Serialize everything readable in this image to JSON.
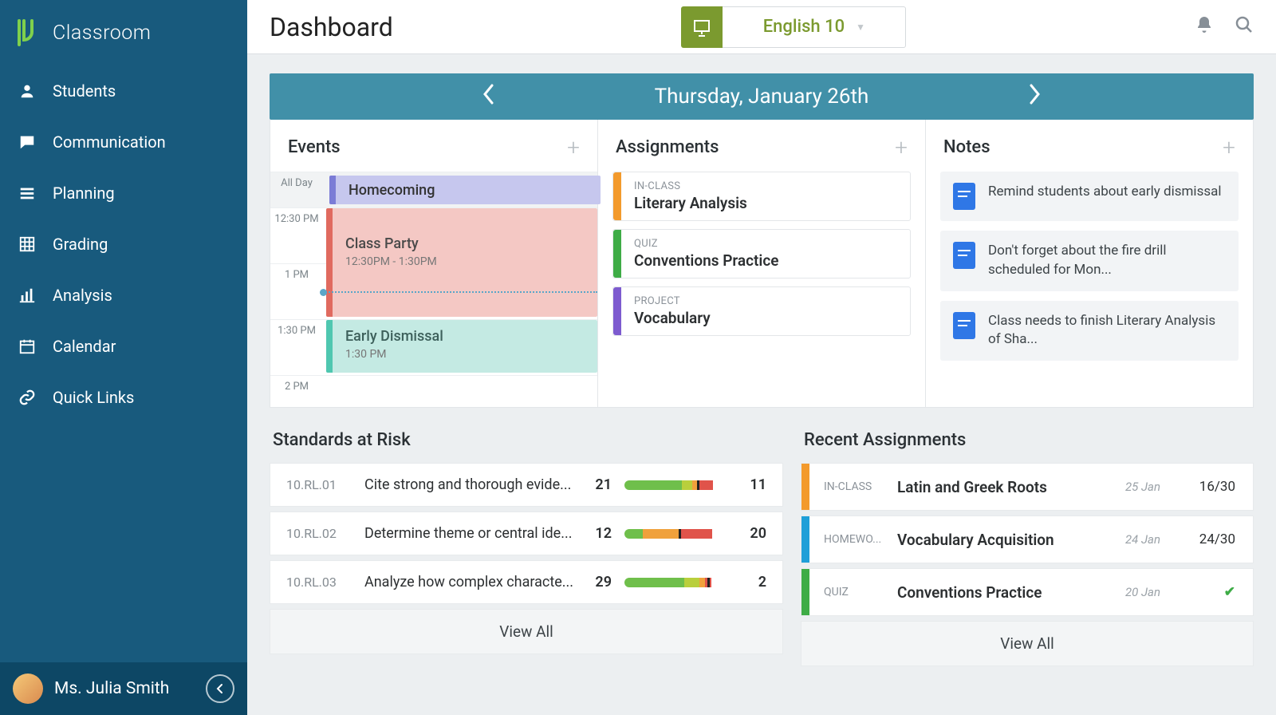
{
  "app": {
    "title": "Classroom"
  },
  "nav": [
    {
      "label": "Students",
      "icon": "person-icon"
    },
    {
      "label": "Communication",
      "icon": "chat-icon"
    },
    {
      "label": "Planning",
      "icon": "list-icon"
    },
    {
      "label": "Grading",
      "icon": "grid-icon"
    },
    {
      "label": "Analysis",
      "icon": "barchart-icon"
    },
    {
      "label": "Calendar",
      "icon": "calendar-icon"
    },
    {
      "label": "Quick Links",
      "icon": "link-icon"
    }
  ],
  "user": {
    "name": "Ms. Julia Smith"
  },
  "header": {
    "page_title": "Dashboard",
    "class_name": "English 10"
  },
  "date_bar": {
    "label": "Thursday, January 26th"
  },
  "panels": {
    "events": {
      "title": "Events",
      "time_labels": [
        "All Day",
        "12:30 PM",
        "1 PM",
        "1:30 PM",
        "2 PM"
      ],
      "items": [
        {
          "title": "Homecoming",
          "slot": "allday",
          "color": "purple"
        },
        {
          "title": "Class Party",
          "time": "12:30PM - 1:30PM",
          "color": "red"
        },
        {
          "title": "Early Dismissal",
          "time": "1:30 PM",
          "color": "teal"
        }
      ]
    },
    "assignments": {
      "title": "Assignments",
      "items": [
        {
          "type": "IN-CLASS",
          "name": "Literary Analysis",
          "color": "orange"
        },
        {
          "type": "QUIZ",
          "name": "Conventions Practice",
          "color": "green"
        },
        {
          "type": "PROJECT",
          "name": "Vocabulary",
          "color": "purple"
        }
      ]
    },
    "notes": {
      "title": "Notes",
      "items": [
        {
          "text": "Remind students about early dismissal"
        },
        {
          "text": "Don't forget about the fire drill scheduled for Mon..."
        },
        {
          "text": "Class needs to finish Literary Analysis of Sha..."
        }
      ]
    }
  },
  "standards": {
    "title": "Standards at Risk",
    "rows": [
      {
        "code": "10.RL.01",
        "desc": "Cite strong and thorough evide...",
        "left": "21",
        "right": "11",
        "segs": [
          [
            "#6fbf4b",
            30
          ],
          [
            "#6fbf4b",
            25
          ],
          [
            "#b9cf3c",
            10
          ],
          [
            "#f0a13c",
            5
          ],
          [
            "#e0534a",
            15
          ]
        ],
        "marker": 70
      },
      {
        "code": "10.RL.02",
        "desc": "Determine theme or central ide...",
        "left": "12",
        "right": "20",
        "segs": [
          [
            "#6fbf4b",
            18
          ],
          [
            "#f0a13c",
            22
          ],
          [
            "#f0a13c",
            15
          ],
          [
            "#e0534a",
            30
          ]
        ],
        "marker": 52
      },
      {
        "code": "10.RL.03",
        "desc": "Analyze how complex characte...",
        "left": "29",
        "right": "2",
        "segs": [
          [
            "#6fbf4b",
            30
          ],
          [
            "#6fbf4b",
            28
          ],
          [
            "#b9cf3c",
            14
          ],
          [
            "#f0a13c",
            6
          ],
          [
            "#e0534a",
            6
          ]
        ],
        "marker": 80
      }
    ],
    "view_all": "View All"
  },
  "recent": {
    "title": "Recent Assignments",
    "rows": [
      {
        "type": "IN-CLASS",
        "name": "Latin and Greek Roots",
        "date": "25 Jan",
        "score": "16/30",
        "color": "orange"
      },
      {
        "type": "HOMEWO...",
        "name": "Vocabulary Acquisition",
        "date": "24 Jan",
        "score": "24/30",
        "color": "blue"
      },
      {
        "type": "QUIZ",
        "name": "Conventions Practice",
        "date": "20 Jan",
        "score": "check",
        "color": "green"
      }
    ],
    "view_all": "View All"
  }
}
